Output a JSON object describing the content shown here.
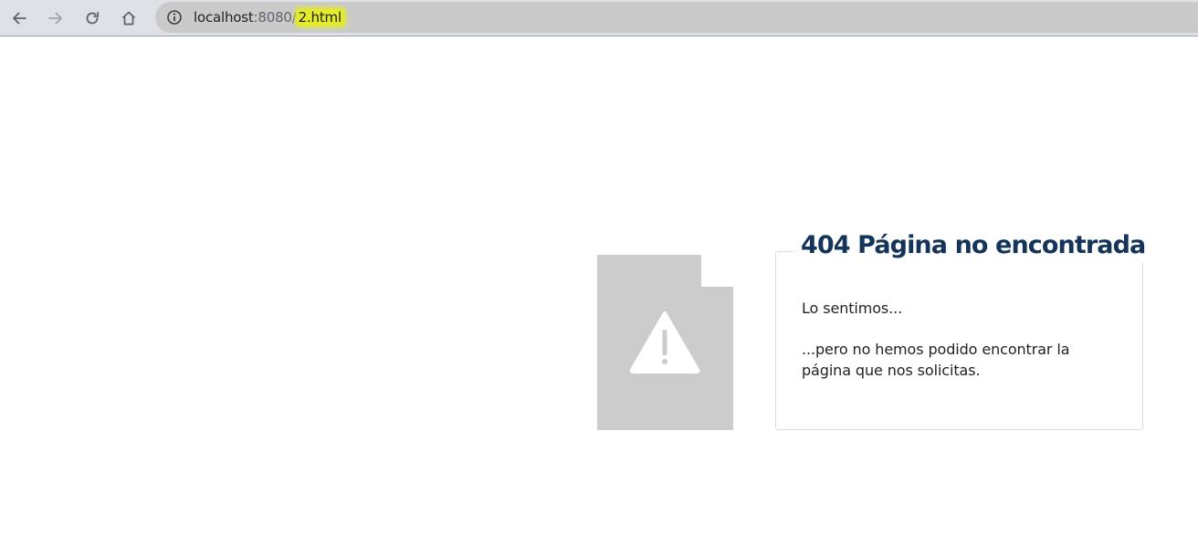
{
  "browser": {
    "back_icon": "arrow-left-icon",
    "forward_icon": "arrow-right-icon",
    "reload_icon": "reload-icon",
    "home_icon": "home-icon",
    "site_info_icon": "info-circle-icon",
    "url_host": "localhost",
    "url_port": ":8080/",
    "url_path": "2.html",
    "highlight_color": "#e3eb2a"
  },
  "error_page": {
    "title": "404 Página no encontrada",
    "message_1": "Lo sentimos...",
    "message_2": "...pero no hemos podido encontrar la página que nos solicitas.",
    "illustration_icon": "warning-document-icon",
    "title_color": "#14345a"
  }
}
